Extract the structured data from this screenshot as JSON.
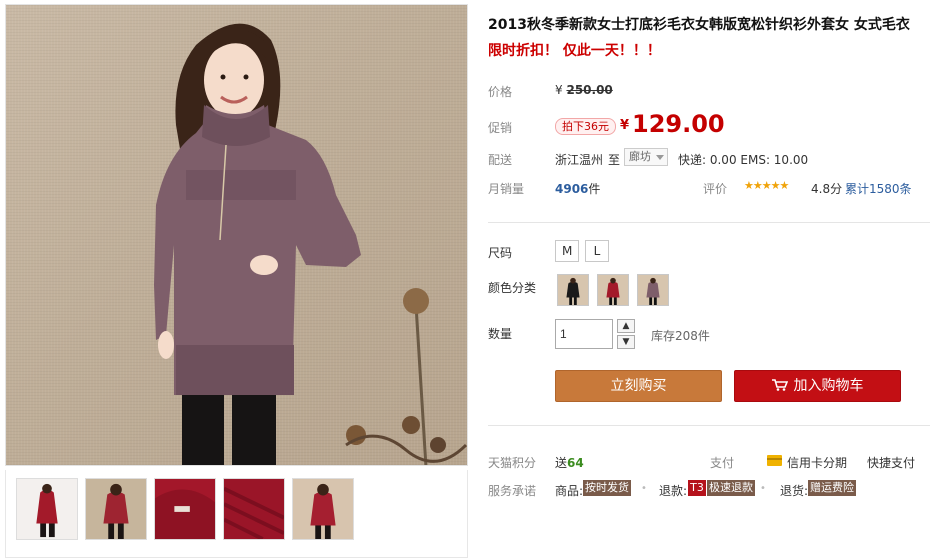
{
  "product": {
    "title": "2013秋冬季新款女士打底衫毛衣女韩版宽松针织衫外套女 女式毛衣",
    "subtitle": "限时折扣！ 仅此一天！！！"
  },
  "price": {
    "label": "价格",
    "original_currency": "¥",
    "original_value": "250.00",
    "promo_label": "促销",
    "promo_badge": "拍下36元",
    "promo_currency": "¥",
    "promo_value": "129.00"
  },
  "shipping": {
    "label": "配送",
    "from": "浙江温州",
    "to_label": "至",
    "destination": "廊坊",
    "cost": "快递: 0.00 EMS: 10.00"
  },
  "sales": {
    "label": "月销量",
    "count": "4906",
    "unit": "件",
    "rating_label": "评价",
    "stars": "★★★★★",
    "score": "4.8分",
    "total_reviews": "累计1580条"
  },
  "options": {
    "size_label": "尺码",
    "sizes": [
      "M",
      "L"
    ],
    "color_label": "颜色分类",
    "colors": [
      "black-swatch",
      "red-swatch",
      "purple-swatch"
    ],
    "qty_label": "数量",
    "qty_value": "1",
    "stock": "库存208件"
  },
  "actions": {
    "buy_now": "立刻购买",
    "add_cart": "加入购物车"
  },
  "service": {
    "points_label": "天猫积分",
    "points_prefix": "送",
    "points_value": "64",
    "pay_label": "支付",
    "pay_installment": "信用卡分期",
    "pay_quick": "快捷支付",
    "promise_label": "服务承诺",
    "goods_label": "商品:",
    "goods_tag": "按时发货",
    "refund_label": "退款:",
    "refund_badge": "T3",
    "refund_tag": "极速退款",
    "return_label": "退货:",
    "return_tag": "赠运费险"
  },
  "colors": {
    "price_red": "#c40000",
    "buy_now_bg": "#c8793a",
    "add_cart_bg": "#c30f14",
    "link_blue": "#2c5d9e",
    "sweater_purple": "#7e5e6a"
  }
}
